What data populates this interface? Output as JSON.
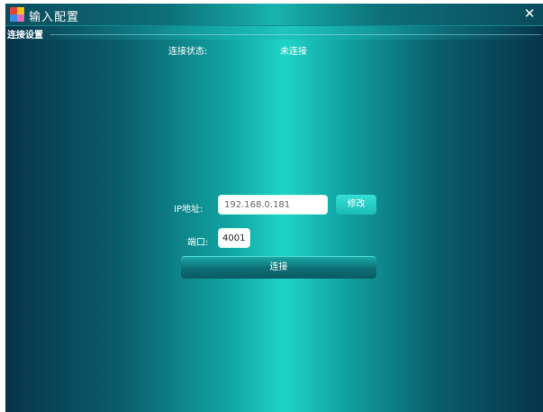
{
  "window": {
    "title": "输入配置",
    "close_symbol": "✕",
    "icon": "app-grid-icon"
  },
  "section": {
    "title": "连接设置"
  },
  "status": {
    "label": "连接状态:",
    "value": "未连接"
  },
  "ip": {
    "label": "IP地址:",
    "value": "192.168.0.181",
    "modify_label": "修改"
  },
  "port": {
    "label": "端口:",
    "value": "4001"
  },
  "connect": {
    "label": "连接"
  },
  "colors": {
    "accent": "#1fd3c7",
    "background_dark": "#07344a",
    "button": "#1bbcb6"
  }
}
